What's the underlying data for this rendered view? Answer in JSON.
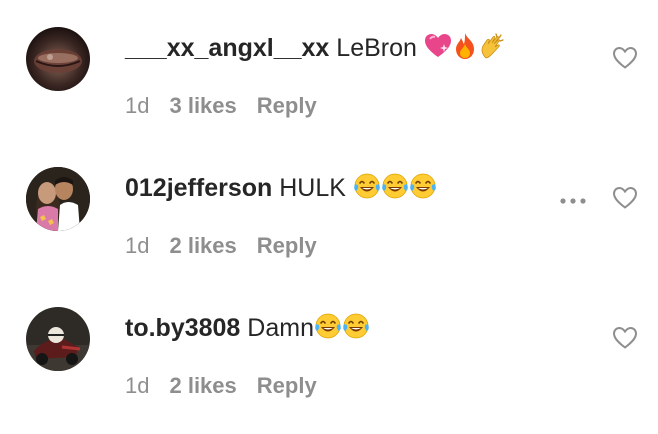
{
  "comments": [
    {
      "username": "___xx_angxl__xx",
      "text": "LeBron",
      "emojis": [
        "sparkling-heart-emoji",
        "fire-emoji",
        "clapping-hands-emoji"
      ],
      "time": "1d",
      "likes": "3 likes",
      "reply": "Reply",
      "avatar": "avatar-lips"
    },
    {
      "username": "012jefferson",
      "text": "HULK",
      "emojis": [
        "tears-of-joy-emoji",
        "tears-of-joy-emoji",
        "tears-of-joy-emoji"
      ],
      "time": "1d",
      "likes": "2 likes",
      "reply": "Reply",
      "avatar": "avatar-couple"
    },
    {
      "username": "to.by3808",
      "text": "Damn",
      "emojis": [
        "tears-of-joy-emoji",
        "tears-of-joy-emoji"
      ],
      "time": "1d",
      "likes": "2 likes",
      "reply": "Reply",
      "avatar": "avatar-kart"
    }
  ],
  "icons": {
    "like": "heart-outline-icon",
    "more": "more-options-icon"
  },
  "colors": {
    "text": "#262626",
    "meta": "#8e8e8e",
    "icon": "#8e8e8e"
  }
}
